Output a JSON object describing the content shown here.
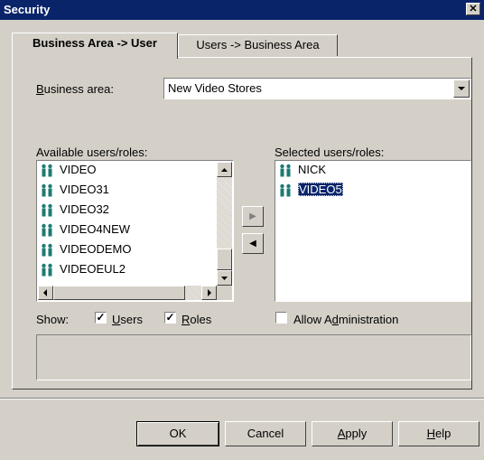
{
  "window": {
    "title": "Security",
    "close_glyph": "✕"
  },
  "tabs": [
    {
      "label": "Business Area -> User",
      "active": true
    },
    {
      "label": "Users -> Business Area",
      "active": false
    }
  ],
  "business_area": {
    "label_prefix": "B",
    "label_rest": "usiness area:",
    "value": "New Video Stores"
  },
  "available": {
    "label": "Available users/roles:",
    "items": [
      "VIDEO",
      "VIDEO31",
      "VIDEO32",
      "VIDEO4NEW",
      "VIDEODEMO",
      "VIDEOEUL2"
    ]
  },
  "selected": {
    "label": "Selected users/roles:",
    "items": [
      "NICK",
      "VIDEO5"
    ],
    "highlighted": "VIDEO5"
  },
  "move_buttons": {
    "add": "▶",
    "remove": "◀"
  },
  "show": {
    "label": "Show:",
    "users": {
      "accel": "U",
      "rest": "sers",
      "checked": true
    },
    "roles": {
      "accel": "R",
      "rest": "oles",
      "checked": true
    }
  },
  "allow_admin": {
    "prefix": "Allow A",
    "accel": "d",
    "rest": "ministration",
    "checked": false
  },
  "buttons": {
    "ok": "OK",
    "cancel": "Cancel",
    "apply_accel": "A",
    "apply_rest": "pply",
    "help_accel": "H",
    "help_rest": "elp"
  },
  "colors": {
    "titlebar": "#0a246a",
    "selection": "#0a246a",
    "face": "#d4d0c8",
    "icon": "#1e7a72"
  }
}
